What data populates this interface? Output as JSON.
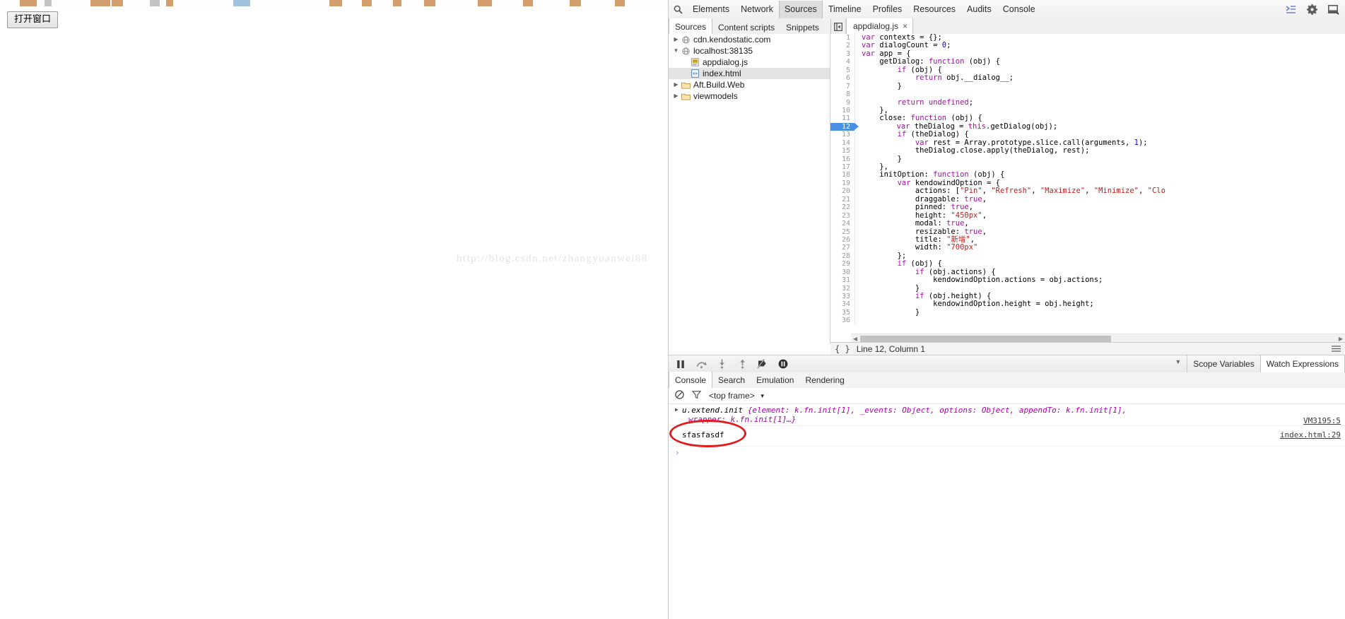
{
  "page": {
    "open_window_button": "打开窗口",
    "watermark": "http://blog.csdn.net/zhangyuanwei88"
  },
  "devtools": {
    "search_icon": "search-icon",
    "panels": [
      {
        "label": "Elements",
        "active": false
      },
      {
        "label": "Network",
        "active": false
      },
      {
        "label": "Sources",
        "active": true
      },
      {
        "label": "Timeline",
        "active": false
      },
      {
        "label": "Profiles",
        "active": false
      },
      {
        "label": "Resources",
        "active": false
      },
      {
        "label": "Audits",
        "active": false
      },
      {
        "label": "Console",
        "active": false
      }
    ],
    "toolbar_right_icons": [
      "dock-drawer-icon",
      "gear-icon",
      "dock-position-icon"
    ],
    "nav_tabs": [
      {
        "label": "Sources",
        "active": true
      },
      {
        "label": "Content scripts",
        "active": false
      },
      {
        "label": "Snippets",
        "active": false
      }
    ],
    "editor_tabs": [
      {
        "label": "appdialog.js",
        "active": true,
        "close": "×"
      }
    ],
    "sidebar_toggle_icon": "collapse-sidebar-icon",
    "file_tree": [
      {
        "label": "cdn.kendostatic.com",
        "twisty": "▶",
        "icon": "globe-icon",
        "indent": 1,
        "selected": false
      },
      {
        "label": "localhost:38135",
        "twisty": "▼",
        "icon": "globe-icon",
        "indent": 1,
        "selected": false
      },
      {
        "label": "appdialog.js",
        "twisty": "",
        "icon": "js-file-icon",
        "indent": 2,
        "selected": false
      },
      {
        "label": "index.html",
        "twisty": "",
        "icon": "html-file-icon",
        "indent": 2,
        "selected": true
      },
      {
        "label": "Aft.Build.Web",
        "twisty": "▶",
        "icon": "folder-icon",
        "indent": 1,
        "selected": false
      },
      {
        "label": "viewmodels",
        "twisty": "▶",
        "icon": "folder-icon",
        "indent": 1,
        "selected": false
      }
    ],
    "code_lines": [
      {
        "n": 1,
        "text": "var contexts = {};",
        "bp": false
      },
      {
        "n": 2,
        "text": "var dialogCount = 0;",
        "bp": false
      },
      {
        "n": 3,
        "text": "var app = {",
        "bp": false
      },
      {
        "n": 4,
        "text": "    getDialog: function (obj) {",
        "bp": false
      },
      {
        "n": 5,
        "text": "        if (obj) {",
        "bp": false
      },
      {
        "n": 6,
        "text": "            return obj.__dialog__;",
        "bp": false
      },
      {
        "n": 7,
        "text": "        }",
        "bp": false
      },
      {
        "n": 8,
        "text": "",
        "bp": false
      },
      {
        "n": 9,
        "text": "        return undefined;",
        "bp": false
      },
      {
        "n": 10,
        "text": "    },",
        "bp": false
      },
      {
        "n": 11,
        "text": "    close: function (obj) {",
        "bp": false
      },
      {
        "n": 12,
        "text": "        var theDialog = this.getDialog(obj);",
        "bp": true
      },
      {
        "n": 13,
        "text": "        if (theDialog) {",
        "bp": false
      },
      {
        "n": 14,
        "text": "            var rest = Array.prototype.slice.call(arguments, 1);",
        "bp": false
      },
      {
        "n": 15,
        "text": "            theDialog.close.apply(theDialog, rest);",
        "bp": false
      },
      {
        "n": 16,
        "text": "        }",
        "bp": false
      },
      {
        "n": 17,
        "text": "    },",
        "bp": false
      },
      {
        "n": 18,
        "text": "    initOption: function (obj) {",
        "bp": false
      },
      {
        "n": 19,
        "text": "        var kendowindOption = {",
        "bp": false
      },
      {
        "n": 20,
        "text": "            actions: [\"Pin\", \"Refresh\", \"Maximize\", \"Minimize\", \"Clo",
        "bp": false
      },
      {
        "n": 21,
        "text": "            draggable: true,",
        "bp": false
      },
      {
        "n": 22,
        "text": "            pinned: true,",
        "bp": false
      },
      {
        "n": 23,
        "text": "            height: \"450px\",",
        "bp": false
      },
      {
        "n": 24,
        "text": "            modal: true,",
        "bp": false
      },
      {
        "n": 25,
        "text": "            resizable: true,",
        "bp": false
      },
      {
        "n": 26,
        "text": "            title: \"新增\",",
        "bp": false
      },
      {
        "n": 27,
        "text": "            width: \"700px\"",
        "bp": false
      },
      {
        "n": 28,
        "text": "        };",
        "bp": false
      },
      {
        "n": 29,
        "text": "        if (obj) {",
        "bp": false
      },
      {
        "n": 30,
        "text": "            if (obj.actions) {",
        "bp": false
      },
      {
        "n": 31,
        "text": "                kendowindOption.actions = obj.actions;",
        "bp": false
      },
      {
        "n": 32,
        "text": "            }",
        "bp": false
      },
      {
        "n": 33,
        "text": "            if (obj.height) {",
        "bp": false
      },
      {
        "n": 34,
        "text": "                kendowindOption.height = obj.height;",
        "bp": false
      },
      {
        "n": 35,
        "text": "            }",
        "bp": false
      },
      {
        "n": 36,
        "text": "",
        "bp": false
      }
    ],
    "editor_status": {
      "pretty_print_icon": "{ }",
      "position": "Line 12, Column 1",
      "menu_icon": "more-options-icon"
    },
    "debug_controls": [
      {
        "icon": "pause-icon",
        "name": "pause-resume-button"
      },
      {
        "icon": "step-over-icon",
        "name": "step-over-button"
      },
      {
        "icon": "step-into-icon",
        "name": "step-into-button"
      },
      {
        "icon": "step-out-icon",
        "name": "step-out-button"
      },
      {
        "icon": "deactivate-breakpoints-icon",
        "name": "deactivate-breakpoints-button"
      },
      {
        "icon": "pause-on-exceptions-icon",
        "name": "pause-on-exceptions-button"
      }
    ],
    "debug_sidebar_tabs": [
      {
        "label": "Scope Variables",
        "active": false
      },
      {
        "label": "Watch Expressions",
        "active": true
      }
    ],
    "drawer_tabs": [
      {
        "label": "Console",
        "active": true
      },
      {
        "label": "Search",
        "active": false
      },
      {
        "label": "Emulation",
        "active": false
      },
      {
        "label": "Rendering",
        "active": false
      }
    ],
    "console_bar": {
      "clear_icon": "clear-console-icon",
      "filter_icon": "filter-icon",
      "frame_value": "<top frame>",
      "frame_caret": "▼"
    },
    "console_messages": [
      {
        "type": "object",
        "arrow": "▶",
        "line1_head": "u.extend.init ",
        "line1_body": "{element: k.fn.init[1], _events: Object, options: Object, appendTo: k.fn.init[1],",
        "line2": "wrapper: k.fn.init[1]…}",
        "source": "VM3195:5"
      },
      {
        "type": "text",
        "text": "sfasfasdf",
        "source": "index.html:29"
      }
    ],
    "console_prompt": "›"
  },
  "colors": {
    "accent_blue": "#4a90e2",
    "string_red": "#c41a16",
    "keyword_purple": "#a112a1",
    "number_blue": "#1c00cf",
    "annotation_red": "#e01b1b"
  }
}
